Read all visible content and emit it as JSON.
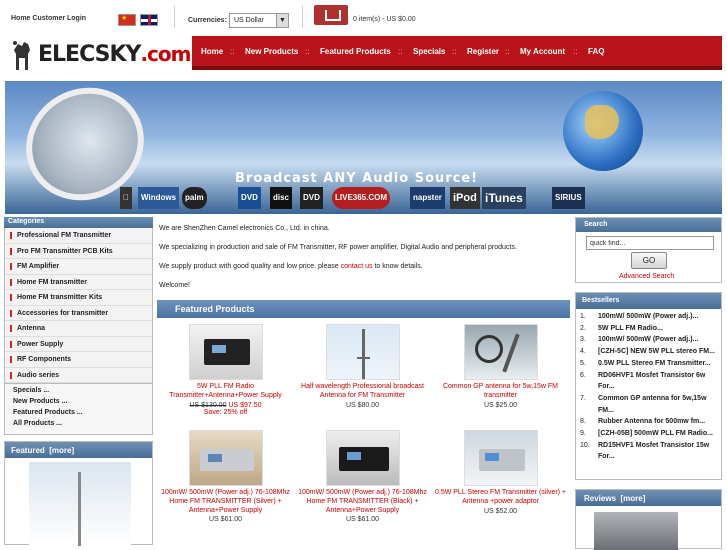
{
  "header": {
    "home_login": "Home Customer Login",
    "currencies_label": "Currencies:",
    "currency_value": "US Dollar",
    "cart_status": "0 item(s) - US $0.00"
  },
  "logo": {
    "brand": "ELECSKY",
    "domain": ".com"
  },
  "nav": {
    "items": [
      "Home",
      "New Products",
      "Featured Products",
      "Specials",
      "Register",
      "My Account",
      "FAQ"
    ],
    "separator": "::"
  },
  "banner": {
    "headline": "Broadcast ANY Audio Source!",
    "logos": [
      "Windows",
      "palm",
      "DVD",
      "disc",
      "DVD",
      "LIVE365.COM",
      "napster",
      "iPod",
      "iTunes",
      "SIRIUS"
    ]
  },
  "categories": {
    "title": "Categories",
    "items": [
      "Professional FM Transmitter",
      "Pro FM Transmitter PCB Kits",
      "FM Amplifier",
      "Home FM transmitter",
      "Home FM transmitter Kits",
      "Accessories for transmitter",
      "Antenna",
      "Power Supply",
      "RF Components",
      "Audio series"
    ],
    "links": [
      "Specials ...",
      "New Products ...",
      "Featured Products ...",
      "All Products ..."
    ]
  },
  "featured_side": {
    "title": "Featured",
    "more": "[more]"
  },
  "intro": {
    "line1": "We are ShenZhen Camel electronics Co., Ltd. in china.",
    "line2": "We specializing in production and sale of FM Transmitter, RF power amplifier, Digital Audio and peripheral products.",
    "line3_before": "We supply product with good quality and low price. please ",
    "line3_link": "contact us",
    "line3_after": " to know details.",
    "line4": "Welcome!"
  },
  "featured_products": {
    "title": "Featured Products",
    "items": [
      {
        "name": "5W PLL FM Radio Transmitter+Antenna+Power Supply",
        "old_price": "US $130.00",
        "price": "US $97.50",
        "save": "Save: 25% off"
      },
      {
        "name": "Half wavelength Professional broadcast Antenna for FM Transmitter",
        "price": "US $80.00"
      },
      {
        "name": "Common GP antenna for 5w,15w FM transmitter",
        "price": "US $25.00"
      },
      {
        "name": "100mW/ 500mW (Power adj.) 76-108Mhz Home FM TRANSMITTER (Silver) + Antenna+Power Supply",
        "price": "US $61.00"
      },
      {
        "name": "100mW/ 500mW (Power adj.) 76-108Mhz Home FM TRANSMITTER (Black) + Antenna+Power Supply",
        "price": "US $61.00"
      },
      {
        "name": "0.5W PLL Stereo FM Transmitter (silver) + Antenna +power adaptor",
        "price": "US $52.00"
      }
    ]
  },
  "search": {
    "title": "Search",
    "placeholder": "quick find...",
    "go": "GO",
    "advanced": "Advanced Search"
  },
  "bestsellers": {
    "title": "Bestsellers",
    "items": [
      {
        "n": "1.",
        "lines": [
          "100mW/ 500mW (Power adj.)..."
        ]
      },
      {
        "n": "2.",
        "lines": [
          "5W PLL FM Radio..."
        ]
      },
      {
        "n": "3.",
        "lines": [
          "100mW/ 500mW (Power adj.)..."
        ]
      },
      {
        "n": "4.",
        "lines": [
          "[CZH-5C] NEW 5W PLL stereo FM..."
        ]
      },
      {
        "n": "5.",
        "lines": [
          "0.5W PLL Stereo FM Transmitter..."
        ]
      },
      {
        "n": "6.",
        "lines": [
          "RD06HVF1 Mosfet Transistor 6w",
          "For..."
        ]
      },
      {
        "n": "7.",
        "lines": [
          "Common GP antenna for 5w,15w",
          "FM..."
        ]
      },
      {
        "n": "8.",
        "lines": [
          "Rubber Antenna for 500mw fm..."
        ]
      },
      {
        "n": "9.",
        "lines": [
          "[CZH-05B] 500mW PLL FM Radio..."
        ]
      },
      {
        "n": "10.",
        "lines": [
          "RD15HVF1 Mosfet Transistor 15w",
          "For..."
        ]
      }
    ]
  },
  "reviews": {
    "title": "Reviews",
    "more": "[more]"
  },
  "colors": {
    "nav_red": "#b8141a",
    "box_blue": "#4a6f97",
    "link_red": "#cc0000"
  }
}
